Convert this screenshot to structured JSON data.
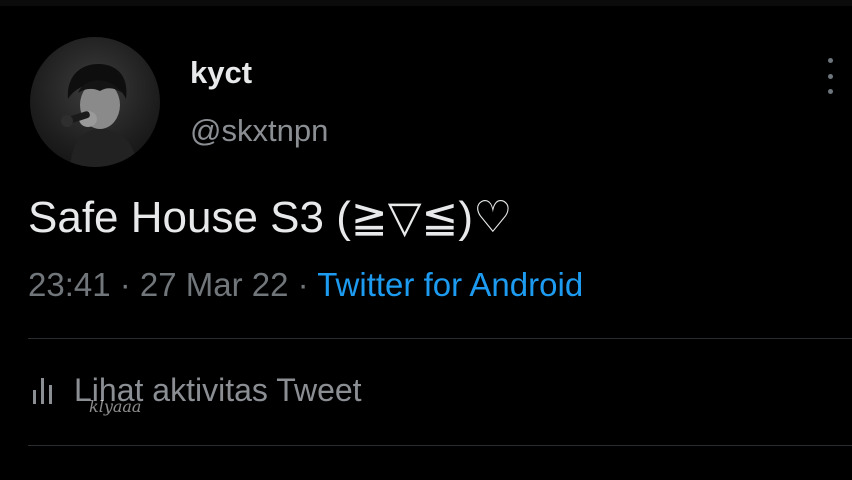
{
  "tweet": {
    "author": {
      "display_name": "kyct",
      "handle": "@skxtnpn",
      "avatar_icon": "profile-photo"
    },
    "text": "Safe House S3 (≧▽≦)♡",
    "timestamp": "23:41 · 27 Mar 22 · ",
    "source": "Twitter for Android",
    "menu_icon": "more-vertical-icon",
    "activity": {
      "icon": "bar-chart-icon",
      "label": "Lihat aktivitas Tweet"
    }
  },
  "watermark": "klyaaa",
  "colors": {
    "background": "#000000",
    "primary_text": "#e7e9ea",
    "secondary_text": "#71767b",
    "link": "#1d9bf0",
    "divider": "#2a2d30"
  }
}
